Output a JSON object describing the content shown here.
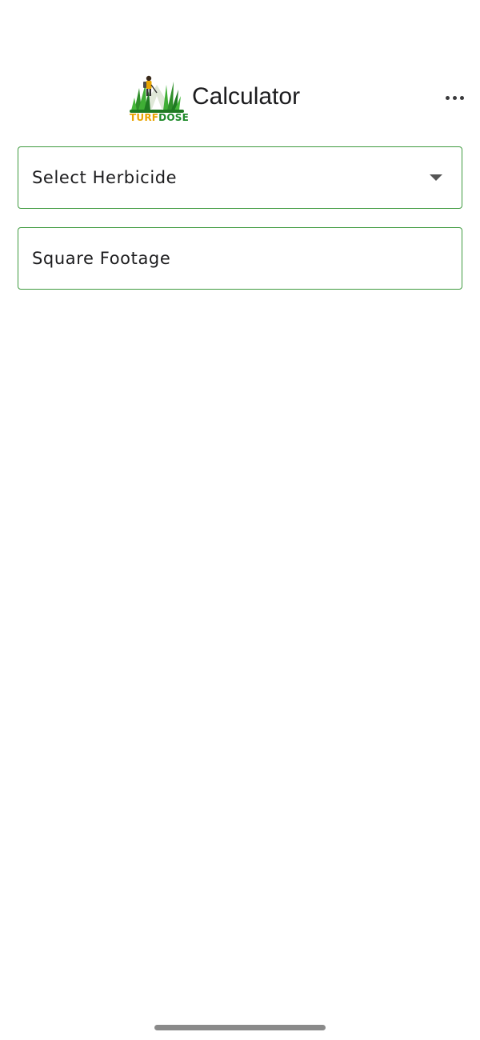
{
  "header": {
    "logo": {
      "icon": "turfdose-logo",
      "text_part1": "TURF",
      "text_part2": "DOSE",
      "color_turf": "#e8a400",
      "color_dose": "#1f8a2a"
    },
    "title": "Calculator",
    "more_icon": "more-horizontal-icon"
  },
  "form": {
    "herbicide_select": {
      "label": "Select Herbicide",
      "icon": "dropdown-caret-icon"
    },
    "square_footage": {
      "placeholder": "Square Footage",
      "value": ""
    }
  },
  "colors": {
    "field_border": "#3f9a3f",
    "background": "#ffffff"
  }
}
